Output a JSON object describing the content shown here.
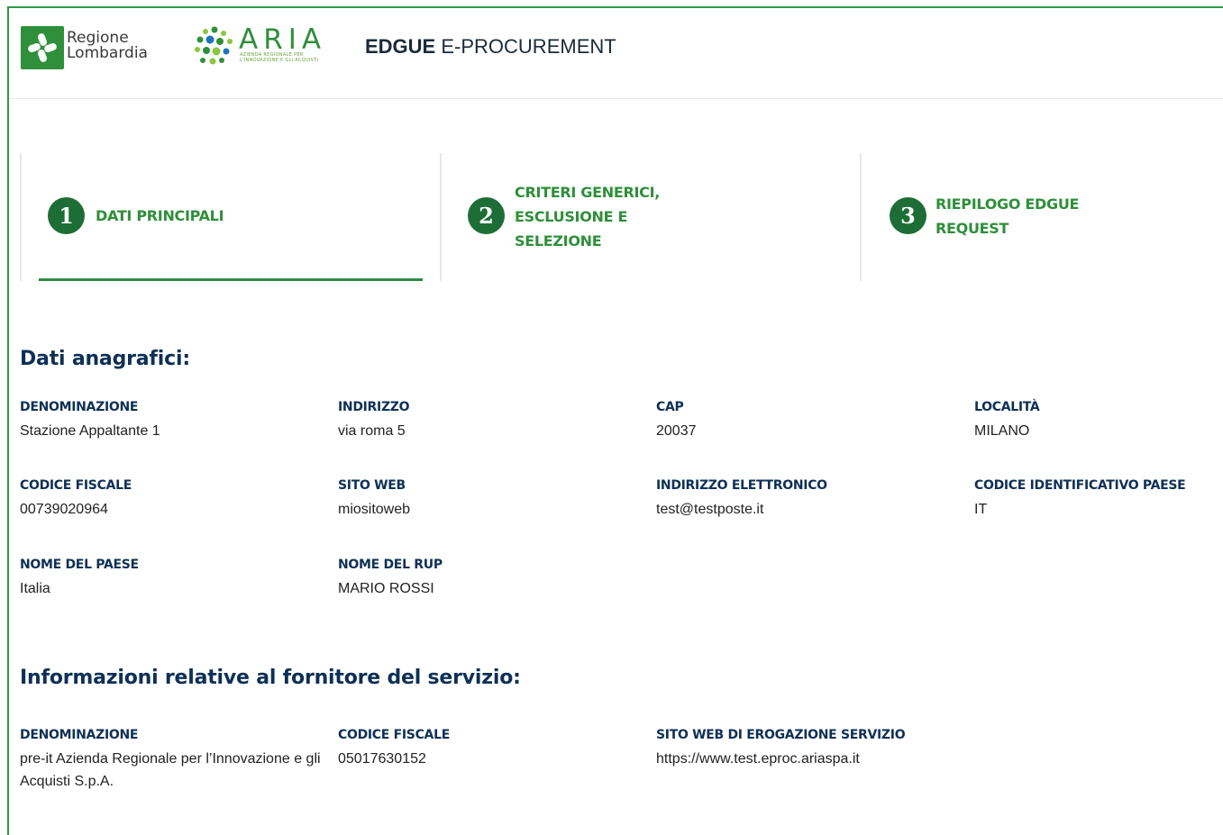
{
  "header": {
    "regione_line1": "Regione",
    "regione_line2": "Lombardia",
    "aria_word": "ARIA",
    "aria_sub1": "AZIENDA REGIONALE PER",
    "aria_sub2": "L'INNOVAZIONE E GLI ACQUISTI",
    "title_bold": "EDGUE",
    "title_rest": " E-PROCUREMENT"
  },
  "steps": [
    {
      "number": "1",
      "label": "DATI PRINCIPALI",
      "active": true
    },
    {
      "number": "2",
      "label_lines": [
        "CRITERI GENERICI,",
        "ESCLUSIONE E",
        "SELEZIONE"
      ],
      "active": false
    },
    {
      "number": "3",
      "label_lines": [
        "RIEPILOGO EDGUE",
        "REQUEST"
      ],
      "active": false
    }
  ],
  "anagrafici": {
    "title": "Dati anagrafici:",
    "fields": [
      {
        "label": "DENOMINAZIONE",
        "value": "Stazione Appaltante 1"
      },
      {
        "label": "INDIRIZZO",
        "value": "via roma 5"
      },
      {
        "label": "CAP",
        "value": "20037"
      },
      {
        "label": "LOCALITÀ",
        "value": "MILANO"
      },
      {
        "label": "CODICE FISCALE",
        "value": "00739020964"
      },
      {
        "label": "SITO WEB",
        "value": "miositoweb"
      },
      {
        "label": "INDIRIZZO ELETTRONICO",
        "value": "test@testposte.it"
      },
      {
        "label": "CODICE IDENTIFICATIVO PAESE",
        "value": "IT"
      },
      {
        "label": "NOME DEL PAESE",
        "value": "Italia"
      },
      {
        "label": "NOME DEL RUP",
        "value": "MARIO ROSSI"
      }
    ]
  },
  "fornitore": {
    "title": "Informazioni relative al fornitore del servizio:",
    "fields": [
      {
        "label": "DENOMINAZIONE",
        "value": "pre-it Azienda Regionale per l’Innovazione e gli Acquisti S.p.A."
      },
      {
        "label": "CODICE FISCALE",
        "value": "05017630152"
      },
      {
        "label": "SITO WEB DI EROGAZIONE SERVIZIO",
        "value": "https://www.test.eproc.ariaspa.it"
      }
    ]
  },
  "colors": {
    "brand_green": "#2f8f3a",
    "step_circle": "#1d6e36",
    "heading_navy": "#0e3055",
    "frame_green": "#2e9a47"
  }
}
